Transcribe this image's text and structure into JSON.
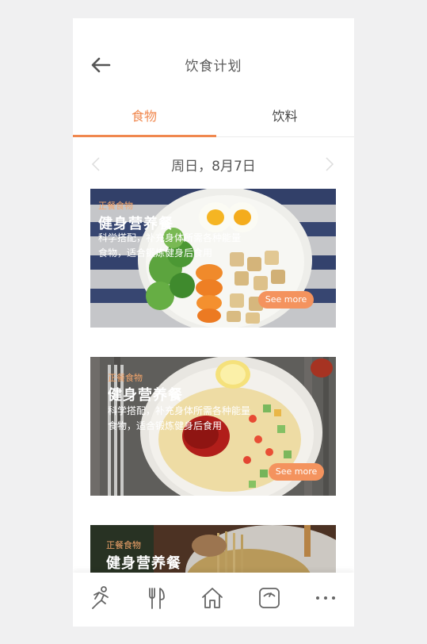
{
  "header": {
    "title": "饮食计划",
    "back_icon": "arrow-left-icon"
  },
  "tabs": [
    {
      "label": "食物",
      "active": true
    },
    {
      "label": "饮料",
      "active": false
    }
  ],
  "date_bar": {
    "date": "周日，8月7日",
    "prev_icon": "chevron-left-icon",
    "next_icon": "chevron-right-icon"
  },
  "cards": [
    {
      "tag": "正餐食物",
      "title": "健身营养餐",
      "desc_line1": "科学搭配，补充身体所需各种能量",
      "desc_line2": "食物，适合锻炼健身后食用",
      "button": "See more"
    },
    {
      "tag": "正餐食物",
      "title": "健身营养餐",
      "desc_line1": "科学搭配，补充身体所需各种能量",
      "desc_line2": "食物，适合锻炼健身后食用",
      "button": "See more"
    },
    {
      "tag": "正餐食物",
      "title": "健身营养餐"
    }
  ],
  "bottom_nav": [
    {
      "icon": "running-icon"
    },
    {
      "icon": "fork-knife-icon"
    },
    {
      "icon": "home-icon"
    },
    {
      "icon": "scale-icon"
    },
    {
      "icon": "more-icon"
    }
  ],
  "colors": {
    "accent": "#f0884f",
    "button": "#f4935e",
    "tag": "#f5a66c",
    "text": "#555555",
    "background": "#f0f0f1"
  }
}
